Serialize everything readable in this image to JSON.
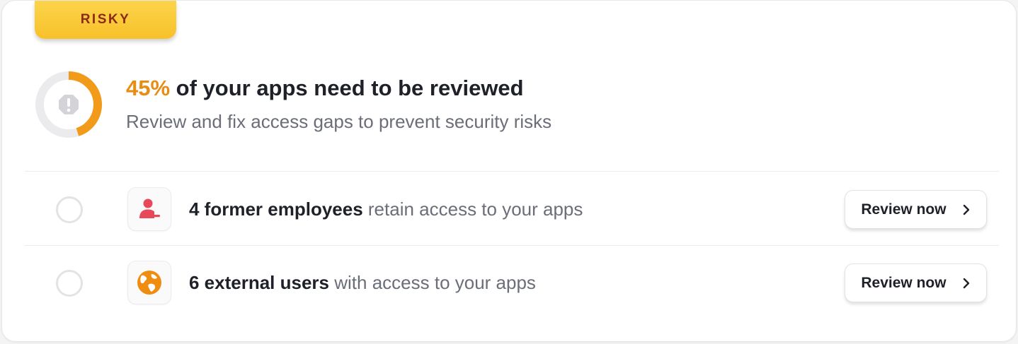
{
  "badge": {
    "label": "RISKY",
    "color": "#8b2a1a",
    "background": "#f9c935"
  },
  "summary": {
    "percent_text": "45%",
    "percent_value": 45,
    "headline_rest": " of your apps need to be reviewed",
    "subtitle": "Review and fix access gaps to prevent security risks",
    "icon": "exclamation-octagon-icon",
    "accent_color": "#f29a1a"
  },
  "items": [
    {
      "icon": "user-minus-icon",
      "icon_color": "#e8495a",
      "bold": "4 former employees",
      "rest": " retain access to your apps",
      "button_label": "Review now",
      "checked": false
    },
    {
      "icon": "globe-icon",
      "icon_color": "#ee8d0f",
      "bold": "6 external users",
      "rest": " with access to your apps",
      "button_label": "Review now",
      "checked": false
    }
  ]
}
